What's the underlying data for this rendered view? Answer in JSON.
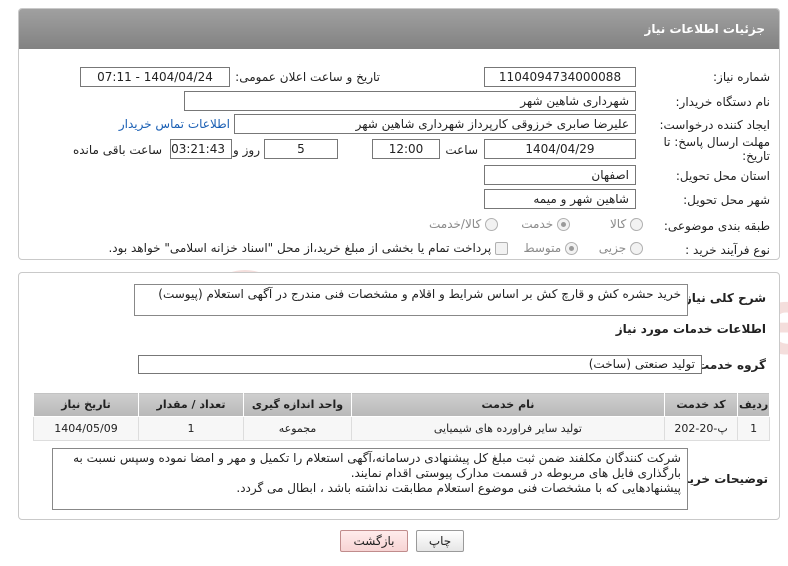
{
  "header": {
    "title": "جزئیات اطلاعات نیاز"
  },
  "fields": {
    "need_number_label": "شماره نیاز:",
    "need_number_value": "1104094734000088",
    "announce_label": "تاریخ و ساعت اعلان عمومی:",
    "announce_value": "1404/04/24 - 07:11",
    "buyer_org_label": "نام دستگاه خریدار:",
    "buyer_org_value": "شهرداری شاهین شهر",
    "creator_label": "ایجاد کننده درخواست:",
    "creator_value": "علیرضا صابری خرزوقی کارپرداز شهرداری شاهین شهر",
    "contact_link": "اطلاعات تماس خریدار",
    "deadline_label": "مهلت ارسال پاسخ: تا تاریخ:",
    "deadline_date": "1404/04/29",
    "time_label": "ساعت",
    "deadline_time": "12:00",
    "days_value": "5",
    "days_label": "روز و",
    "remaining_value": "03:21:43",
    "remaining_label": "ساعت باقی مانده",
    "province_label": "استان محل تحویل:",
    "province_value": "اصفهان",
    "city_label": "شهر محل تحویل:",
    "city_value": "شاهین شهر و میمه",
    "category_label": "طبقه بندی موضوعی:",
    "category_options": [
      "کالا",
      "خدمت",
      "کالا/خدمت"
    ],
    "process_label": "نوع فرآیند خرید :",
    "process_options": [
      "جزیی",
      "متوسط"
    ],
    "treasury_text": "پرداخت تمام یا بخشی از مبلغ خرید،از محل \"اسناد خزانه اسلامی\" خواهد بود."
  },
  "description": {
    "label": "شرح کلی نیاز:",
    "value": "خرید حشره کش و قارچ کش بر اساس شرایط و اقلام و مشخصات فنی مندرج در آگهی استعلام (پیوست)"
  },
  "services": {
    "title": "اطلاعات خدمات مورد نیاز",
    "group_label": "گروه خدمت:",
    "group_value": "تولید صنعتی (ساخت)",
    "columns": [
      "ردیف",
      "کد خدمت",
      "نام خدمت",
      "واحد اندازه گیری",
      "تعداد / مقدار",
      "تاریخ نیاز"
    ],
    "rows": [
      [
        "1",
        "پ-20-202",
        "تولید سایر فراورده های شیمیایی",
        "مجموعه",
        "1",
        "1404/05/09"
      ]
    ]
  },
  "buyer_notes": {
    "label": "توضیحات خریدار:",
    "line1": "شرکت کنندگان مکلفند ضمن ثبت مبلغ کل پیشنهادی درسامانه،آگهی استعلام را  تکمیل و مهر و امضا نموده وسپس نسبت به بارگذاری فایل های مربوطه در قسمت مدارک پیوستی اقدام نمایند.",
    "line2": "پیشنهادهایی که با مشخصات فنی موضوع استعلام مطابقت نداشته باشد ، ابطال می گردد."
  },
  "buttons": {
    "print": "چاپ",
    "back": "بازگشت"
  },
  "watermark": {
    "text": "AriaTender.net"
  },
  "colors": {
    "header_bg": "#8f8f8f",
    "link": "#1a5fb4",
    "watermark": "#c0392b"
  }
}
